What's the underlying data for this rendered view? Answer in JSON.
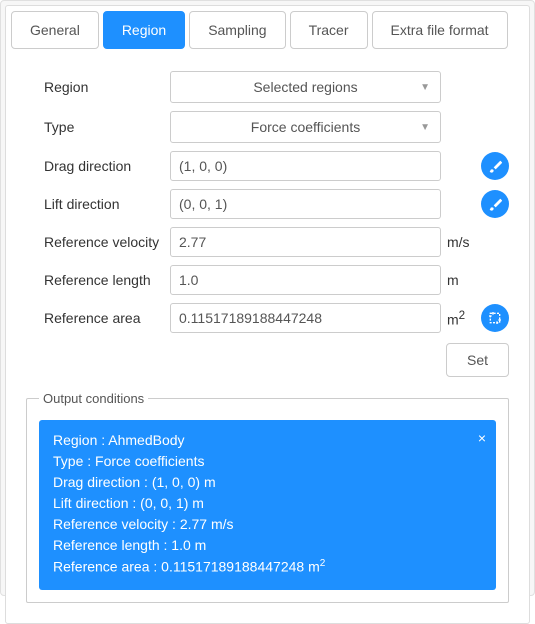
{
  "tabs": {
    "general": "General",
    "region": "Region",
    "sampling": "Sampling",
    "tracer": "Tracer",
    "extra": "Extra file format"
  },
  "form": {
    "region_label": "Region",
    "region_value": "Selected regions",
    "type_label": "Type",
    "type_value": "Force coefficients",
    "drag_label": "Drag direction",
    "drag_value": "(1, 0, 0)",
    "lift_label": "Lift direction",
    "lift_value": "(0, 0, 1)",
    "refvel_label": "Reference velocity",
    "refvel_value": "2.77",
    "refvel_unit": "m/s",
    "reflen_label": "Reference length",
    "reflen_value": "1.0",
    "reflen_unit": "m",
    "refarea_label": "Reference area",
    "refarea_value": "0.11517189188447248",
    "refarea_unit_base": "m",
    "refarea_unit_exp": "2"
  },
  "set_button": "Set",
  "output": {
    "legend": "Output conditions",
    "region_line": "Region : AhmedBody",
    "type_line": "Type : Force coefficients",
    "drag_line": "Drag direction : (1, 0, 0) m",
    "lift_line": "Lift direction : (0, 0, 1) m",
    "refvel_line": "Reference velocity : 2.77 m/s",
    "reflen_line": "Reference length : 1.0 m",
    "refarea_line_base": "Reference area : 0.11517189188447248 m",
    "refarea_line_exp": "2",
    "close": "×"
  }
}
